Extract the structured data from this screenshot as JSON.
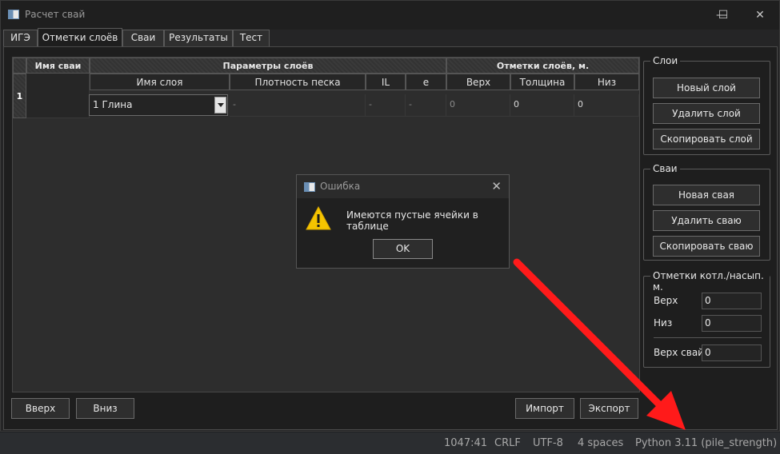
{
  "window": {
    "title": "Расчет свай",
    "minimize": "—",
    "maximize": "☐",
    "close": "✕"
  },
  "tabs": [
    {
      "label": "ИГЭ"
    },
    {
      "label": "Отметки слоёв",
      "active": true
    },
    {
      "label": "Сваи"
    },
    {
      "label": "Результаты"
    },
    {
      "label": "Тест"
    }
  ],
  "table": {
    "header_pile_name": "Имя сваи",
    "header_layer_params": "Параметры слоёв",
    "header_layer_marks": "Отметки слоёв, м.",
    "sub_headers": [
      "Имя слоя",
      "Плотность песка",
      "IL",
      "e",
      "Верх",
      "Толщина",
      "Низ"
    ],
    "row_number": "1",
    "row": {
      "layer_name": "1 Глина",
      "sand_density": "-",
      "il": "-",
      "e": "-",
      "top": "0",
      "thickness": "0",
      "bottom": "0"
    }
  },
  "groups": {
    "layers": {
      "title": "Слои",
      "new": "Новый слой",
      "delete": "Удалить слой",
      "copy": "Скопировать слой"
    },
    "piles": {
      "title": "Сваи",
      "new": "Новая свая",
      "delete": "Удалить сваю",
      "copy": "Скопировать сваю"
    },
    "marks": {
      "title": "Отметки котл./насып. м.",
      "top_label": "Верх",
      "top_value": "0",
      "bottom_label": "Низ",
      "bottom_value": "0",
      "pile_top_label": "Верх свай",
      "pile_top_value": "0"
    }
  },
  "bottom_buttons": {
    "up": "Вверх",
    "down": "Вниз",
    "import": "Импорт",
    "export": "Экспорт"
  },
  "dialog": {
    "title": "Ошибка",
    "icon": "warning-icon",
    "message": "Имеются пустые ячейки в таблице",
    "ok": "OK"
  },
  "statusbar": {
    "position": "1047:41",
    "line_endings": "CRLF",
    "encoding": "UTF-8",
    "indent": "4 spaces",
    "interpreter": "Python 3.11 (pile_strength)"
  },
  "colors": {
    "annotation_arrow": "#ff1a1a",
    "warning": "#f5c400"
  }
}
